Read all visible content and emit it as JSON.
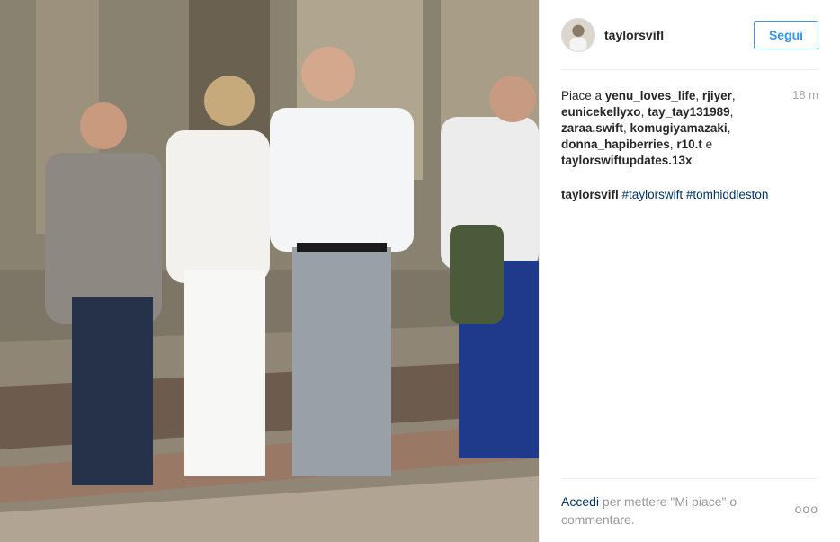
{
  "post": {
    "username": "taylorsvifl",
    "follow_label": "Segui",
    "likes_prefix": "Piace a ",
    "liked_by": [
      "yenu_loves_life",
      "rjiyer",
      "eunicekellyxo",
      "tay_tay131989",
      "zaraa.swift",
      "komugiyamazaki",
      "donna_hapiberries",
      "r10.t"
    ],
    "likes_and": " e ",
    "liked_last": "taylorswiftupdates.13x",
    "time": "18 m",
    "caption_user": "taylorsvifl",
    "hashtags": [
      "#taylorswift",
      "#tomhiddleston"
    ]
  },
  "footer": {
    "login_label": "Accedi",
    "prompt": " per mettere \"Mi piace\" o commentare.",
    "more_label": "ooo"
  },
  "colors": {
    "accent": "#3897f0",
    "link": "#003569",
    "muted": "#999999"
  },
  "icons": {
    "more": "ellipsis-icon",
    "avatar": "profile-photo"
  }
}
